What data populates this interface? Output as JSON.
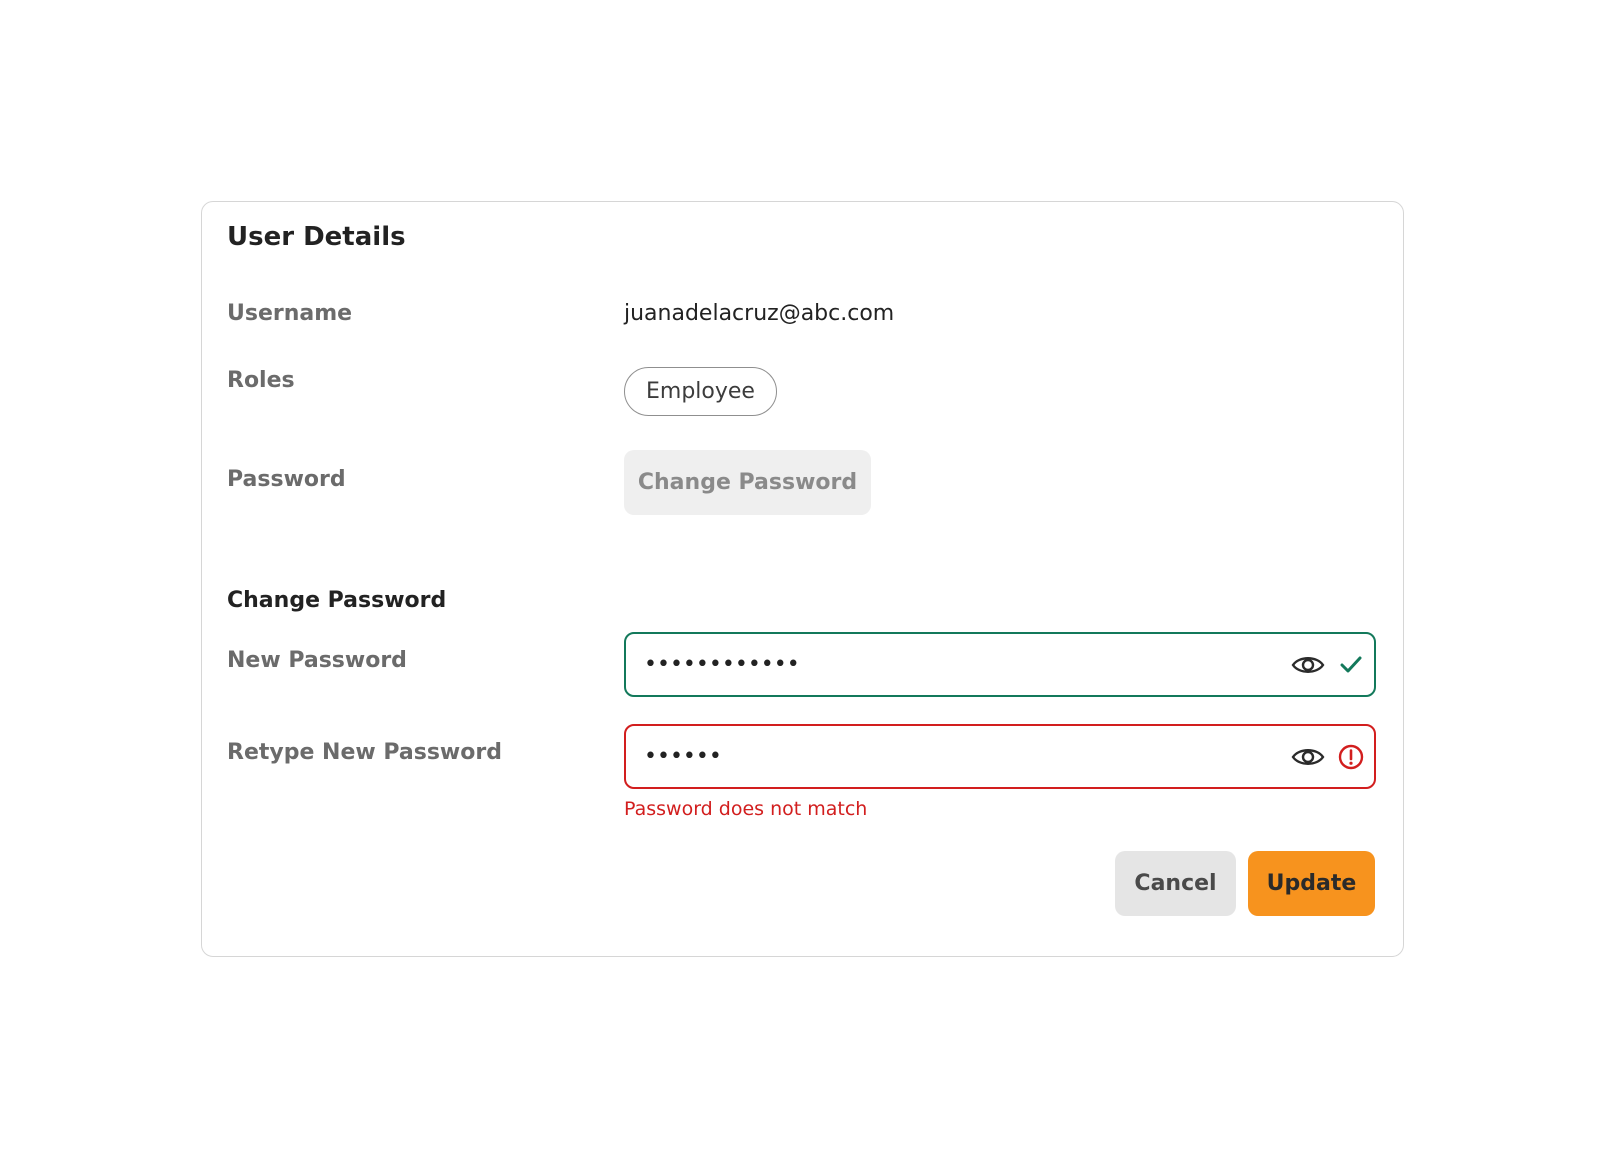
{
  "card": {
    "title": "User Details"
  },
  "details": {
    "username_label": "Username",
    "username_value": "juanadelacruz@abc.com",
    "roles_label": "Roles",
    "role_chip": "Employee",
    "password_label": "Password",
    "change_password_button": "Change Password"
  },
  "change_password": {
    "section_title": "Change Password",
    "new_password_label": "New Password",
    "new_password_value": "••••••••••••",
    "new_password_status": "check-icon",
    "retype_label": "Retype New Password",
    "retype_value": "••••••",
    "retype_status": "error-icon",
    "error_message": "Password does not match"
  },
  "actions": {
    "cancel_label": "Cancel",
    "update_label": "Update"
  },
  "colors": {
    "success": "#13795b",
    "error": "#d21e1e",
    "primary": "#f7931e"
  }
}
